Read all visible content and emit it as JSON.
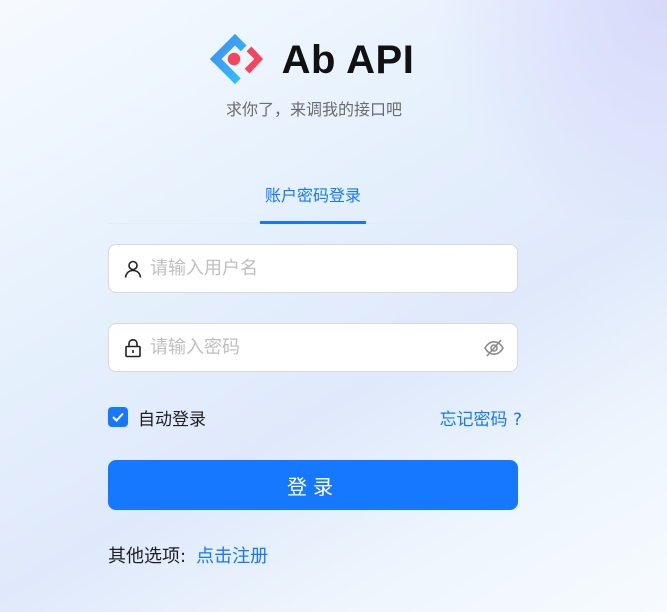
{
  "app": {
    "title": "Ab API",
    "subtitle": "求你了，来调我的接口吧"
  },
  "tabs": [
    {
      "label": "账户密码登录",
      "active": true
    }
  ],
  "form": {
    "username": {
      "placeholder": "请输入用户名",
      "value": ""
    },
    "password": {
      "placeholder": "请输入密码",
      "value": ""
    },
    "remember_label": "自动登录",
    "remember_checked": true,
    "forgot_label": "忘记密码 ?",
    "submit_label": "登录"
  },
  "footer": {
    "other_label": "其他选项:",
    "register_label": "点击注册"
  },
  "colors": {
    "accent": "#1677ff",
    "logo_red": "#f5455c"
  },
  "icons": {
    "logo": "ant-design-logo",
    "username": "user-icon",
    "password": "lock-icon",
    "visibility": "eye-invisible-icon",
    "checkbox": "check-icon"
  }
}
